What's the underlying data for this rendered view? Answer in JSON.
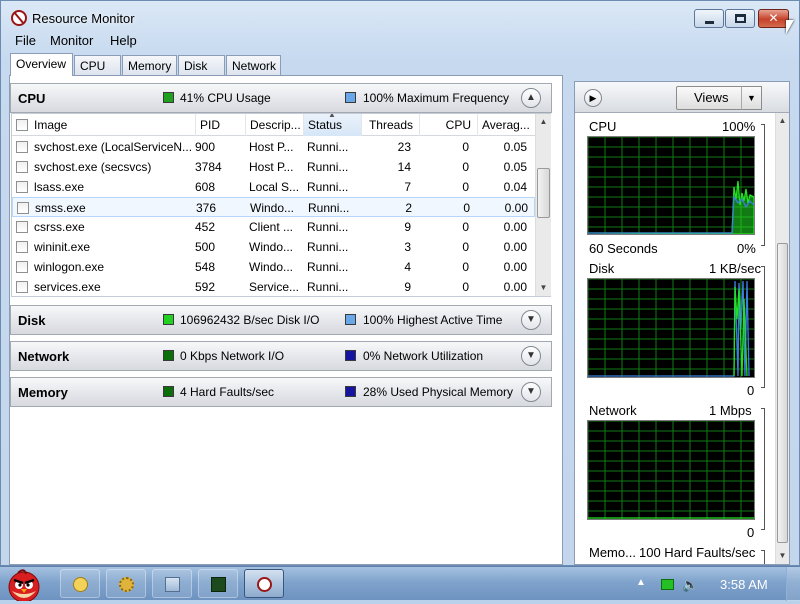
{
  "window": {
    "title": "Resource Monitor"
  },
  "menu": [
    "File",
    "Monitor",
    "Help"
  ],
  "tabs": [
    "Overview",
    "CPU",
    "Memory",
    "Disk",
    "Network"
  ],
  "active_tab": "Overview",
  "sections": {
    "cpu": {
      "title": "CPU",
      "metric1": "41% CPU Usage",
      "metric1_color": "#1fa01f",
      "metric2": "100% Maximum Frequency",
      "metric2_color": "#6aa7e8",
      "expanded": true
    },
    "disk": {
      "title": "Disk",
      "metric1": "106962432 B/sec Disk I/O",
      "metric1_color": "#22d022",
      "metric2": "100% Highest Active Time",
      "metric2_color": "#6aa7e8",
      "expanded": false
    },
    "network": {
      "title": "Network",
      "metric1": "0 Kbps Network I/O",
      "metric1_color": "#0b6e0b",
      "metric2": "0% Network Utilization",
      "metric2_color": "#1414a0",
      "expanded": false
    },
    "memory": {
      "title": "Memory",
      "metric1": "4 Hard Faults/sec",
      "metric1_color": "#0b6e0b",
      "metric2": "28% Used Physical Memory",
      "metric2_color": "#1414a0",
      "expanded": false
    }
  },
  "cpu_table": {
    "columns": [
      "Image",
      "PID",
      "Descrip...",
      "Status",
      "Threads",
      "CPU",
      "Averag..."
    ],
    "sorted_column": "Status",
    "rows": [
      [
        "svchost.exe (LocalServiceN...",
        "900",
        "Host P...",
        "Runni...",
        "23",
        "0",
        "0.05"
      ],
      [
        "svchost.exe (secsvcs)",
        "3784",
        "Host P...",
        "Runni...",
        "14",
        "0",
        "0.05"
      ],
      [
        "lsass.exe",
        "608",
        "Local S...",
        "Runni...",
        "7",
        "0",
        "0.04"
      ],
      [
        "smss.exe",
        "376",
        "Windo...",
        "Runni...",
        "2",
        "0",
        "0.00"
      ],
      [
        "csrss.exe",
        "452",
        "Client ...",
        "Runni...",
        "9",
        "0",
        "0.00"
      ],
      [
        "wininit.exe",
        "500",
        "Windo...",
        "Runni...",
        "3",
        "0",
        "0.00"
      ],
      [
        "winlogon.exe",
        "548",
        "Windo...",
        "Runni...",
        "4",
        "0",
        "0.00"
      ],
      [
        "services.exe",
        "592",
        "Service...",
        "Runni...",
        "9",
        "0",
        "0.00"
      ]
    ],
    "selected_row": 3
  },
  "graphs_panel": {
    "views_label": "Views",
    "graphs": [
      {
        "name": "CPU",
        "max": "100%",
        "footer_left": "60 Seconds",
        "footer_right": "0%"
      },
      {
        "name": "Disk",
        "max": "1 KB/sec",
        "footer_left": "",
        "footer_right": "0"
      },
      {
        "name": "Network",
        "max": "1 Mbps",
        "footer_left": "",
        "footer_right": "0"
      },
      {
        "name": "Memo...",
        "max": "100 Hard Faults/sec",
        "footer_left": "",
        "footer_right": ""
      }
    ]
  },
  "taskbar": {
    "clock": "3:58 AM"
  },
  "colors": {
    "graph_grid": "#127a12",
    "graph_line_green": "#22e022",
    "graph_line_blue": "#3b7fe0"
  }
}
